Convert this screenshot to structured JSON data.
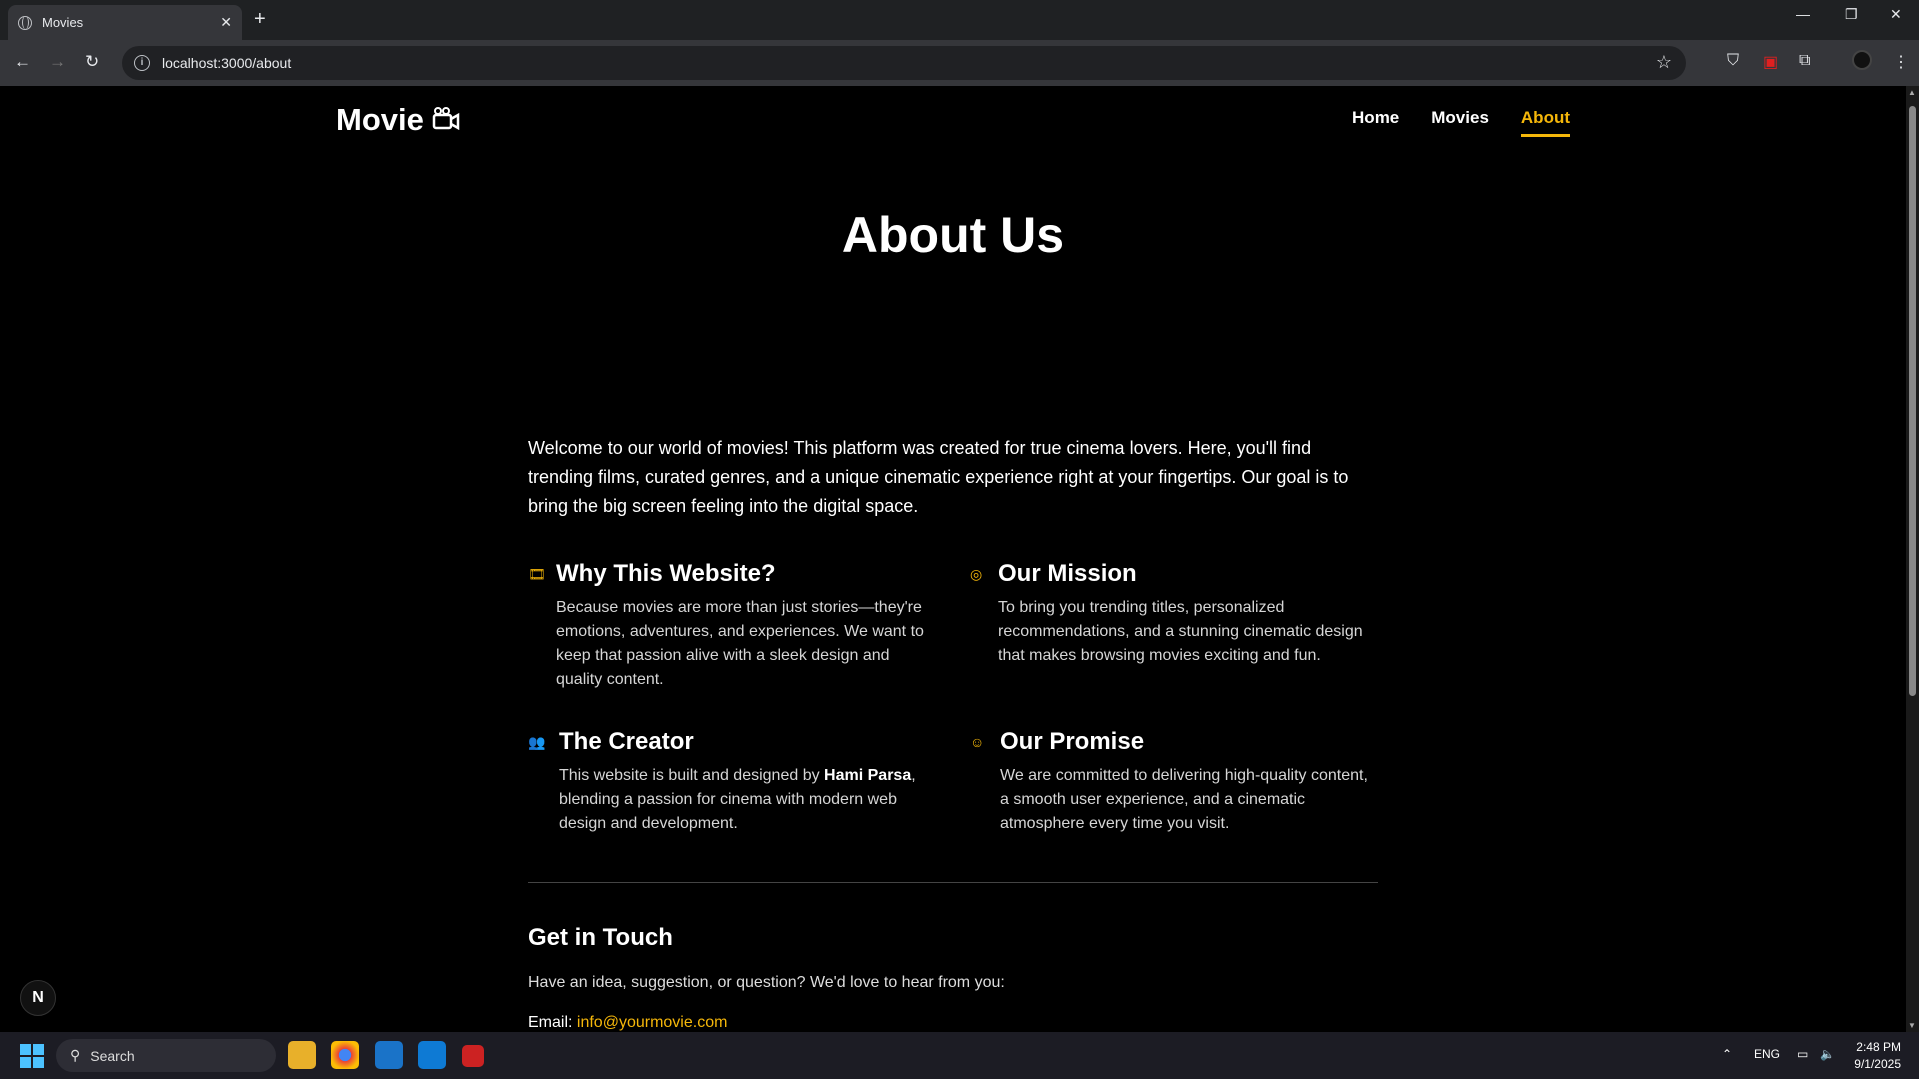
{
  "browser": {
    "tab_title": "Movies",
    "tab_close": "✕",
    "new_tab": "+",
    "url": "localhost:3000/about",
    "minimize": "—",
    "restore": "❐",
    "close": "✕"
  },
  "site": {
    "logo_text": "Movie",
    "nav": [
      {
        "label": "Home",
        "active": false
      },
      {
        "label": "Movies",
        "active": false
      },
      {
        "label": "About",
        "active": true
      }
    ]
  },
  "about": {
    "title": "About Us",
    "intro": "Welcome to our world of movies! This platform was created for true cinema lovers. Here, you'll find trending films, curated genres, and a unique cinematic experience right at your fingertips. Our goal is to bring the big screen feeling into the digital space.",
    "cards": [
      {
        "icon": "film-icon",
        "glyph": "🎞",
        "title": "Why This Website?",
        "text": "Because movies are more than just stories—they're emotions, adventures, and experiences. We want to keep that passion alive with a sleek design and quality content."
      },
      {
        "icon": "target-icon",
        "glyph": "◎",
        "title": "Our Mission",
        "text": "To bring you trending titles, personalized recommendations, and a stunning cinematic design that makes browsing movies exciting and fun."
      },
      {
        "icon": "users-icon",
        "glyph": "👥",
        "title": "The Creator",
        "text_before": "This website is built and designed by ",
        "text_bold": "Hami Parsa",
        "text_after": ", blending a passion for cinema with modern web design and development."
      },
      {
        "icon": "smile-icon",
        "glyph": "☺",
        "title": "Our Promise",
        "text": "We are committed to delivering high-quality content, a smooth user experience, and a cinematic atmosphere every time you visit."
      }
    ],
    "contact": {
      "title": "Get in Touch",
      "text": "Have an idea, suggestion, or question? We'd love to hear from you:",
      "email_label": "Email: ",
      "email": "info@yourmovie.com"
    }
  },
  "next_badge": "N",
  "taskbar": {
    "search_placeholder": "Search",
    "lang": "ENG",
    "time": "2:48 PM",
    "date": "9/1/2025"
  },
  "colors": {
    "accent": "#f5b70a",
    "background": "#000000"
  }
}
